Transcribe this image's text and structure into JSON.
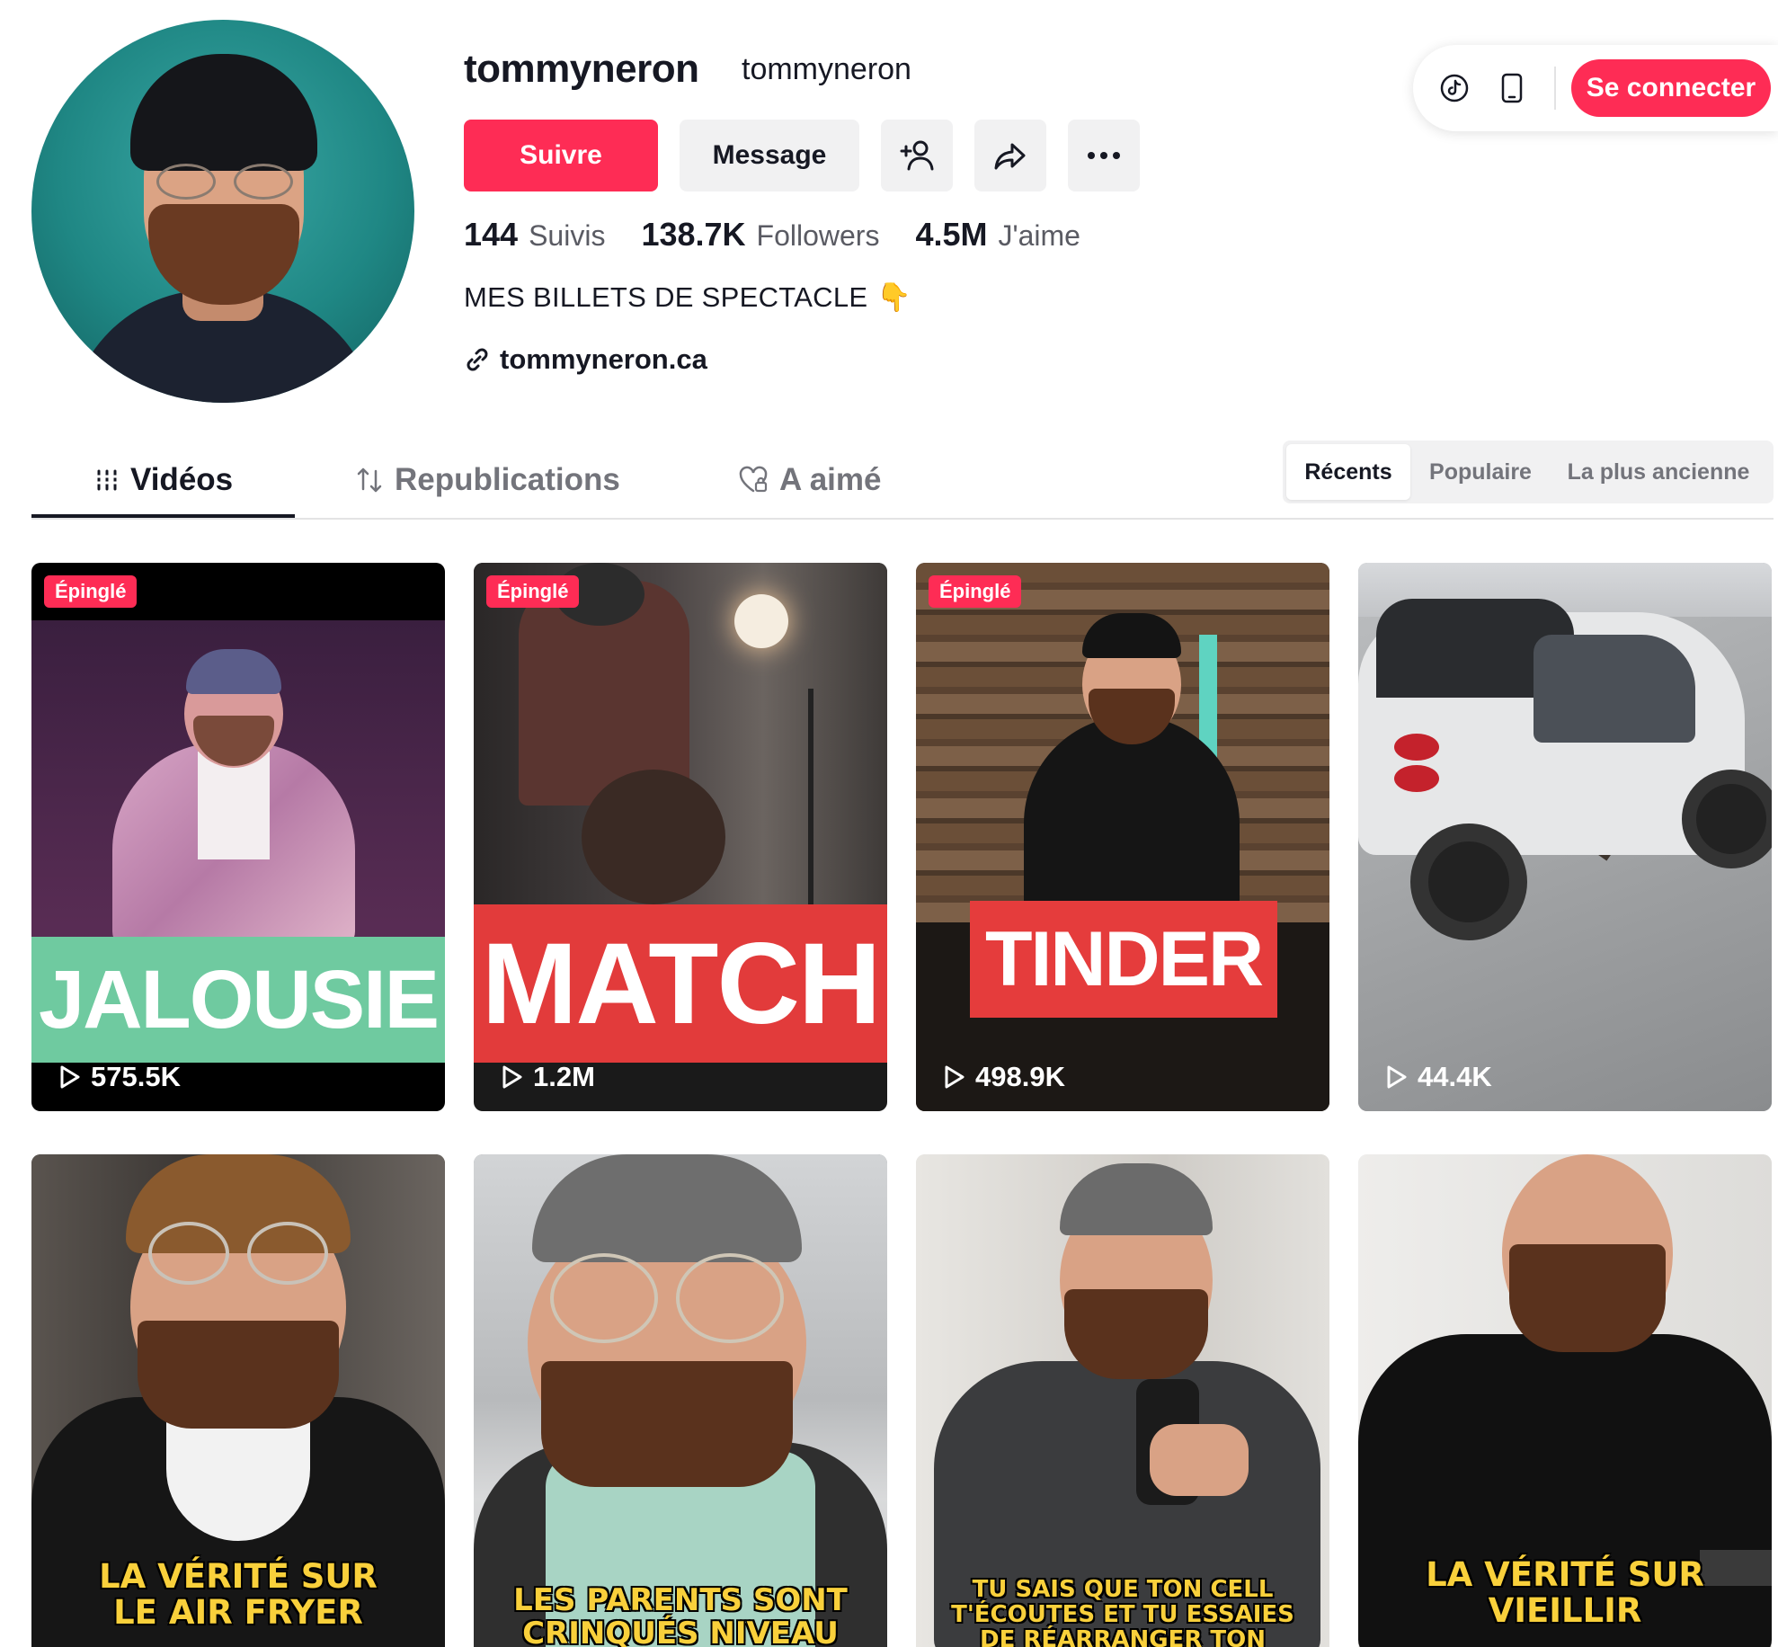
{
  "profile": {
    "username": "tommyneron",
    "nickname": "tommyneron",
    "follow_label": "Suivre",
    "message_label": "Message",
    "stats": [
      {
        "value": "144",
        "label": "Suivis"
      },
      {
        "value": "138.7K",
        "label": "Followers"
      },
      {
        "value": "4.5M",
        "label": "J'aime"
      }
    ],
    "bio": "MES BILLETS DE SPECTACLE",
    "bio_emoji": "👇",
    "link": "tommyneron.ca"
  },
  "topbar": {
    "login_label": "Se connecter",
    "icons": [
      "tiktok-icon",
      "phone-icon"
    ]
  },
  "tabs": [
    {
      "label": "Vidéos",
      "active": true
    },
    {
      "label": "Republications",
      "active": false
    },
    {
      "label": "A aimé",
      "active": false
    }
  ],
  "sort": [
    {
      "label": "Récents",
      "active": true
    },
    {
      "label": "Populaire",
      "active": false
    },
    {
      "label": "La plus ancienne",
      "active": false
    }
  ],
  "videos": [
    {
      "pinned_label": "Épinglé",
      "overlay": "JALOUSIE",
      "views": "575.5K"
    },
    {
      "pinned_label": "Épinglé",
      "overlay": "MATCH",
      "views": "1.2M"
    },
    {
      "pinned_label": "Épinglé",
      "overlay": "TINDER",
      "views": "498.9K"
    },
    {
      "pinned_label": "",
      "overlay": "",
      "views": "44.4K"
    },
    {
      "overlay": "LA VÉRITÉ SUR\nLE AIR FRYER"
    },
    {
      "overlay": "LES PARENTS SONT\nCRINQUÉS NIVEAU"
    },
    {
      "overlay": "TU SAIS QUE TON CELL\nT'ÉCOUTES ET TU ESSAIES\nDE RÉARRANGER TON"
    },
    {
      "overlay": "LA VÉRITÉ SUR\nVIEILLIR"
    }
  ],
  "colors": {
    "brand": "#fe2c55",
    "text": "#161823",
    "muted": "#73747b",
    "surface": "#f1f1f2",
    "caption_yellow": "#f9d03b",
    "jalousie_band": "#6fcaa0",
    "match_band": "#e23b3b",
    "tinder_band": "#e53c3c"
  }
}
